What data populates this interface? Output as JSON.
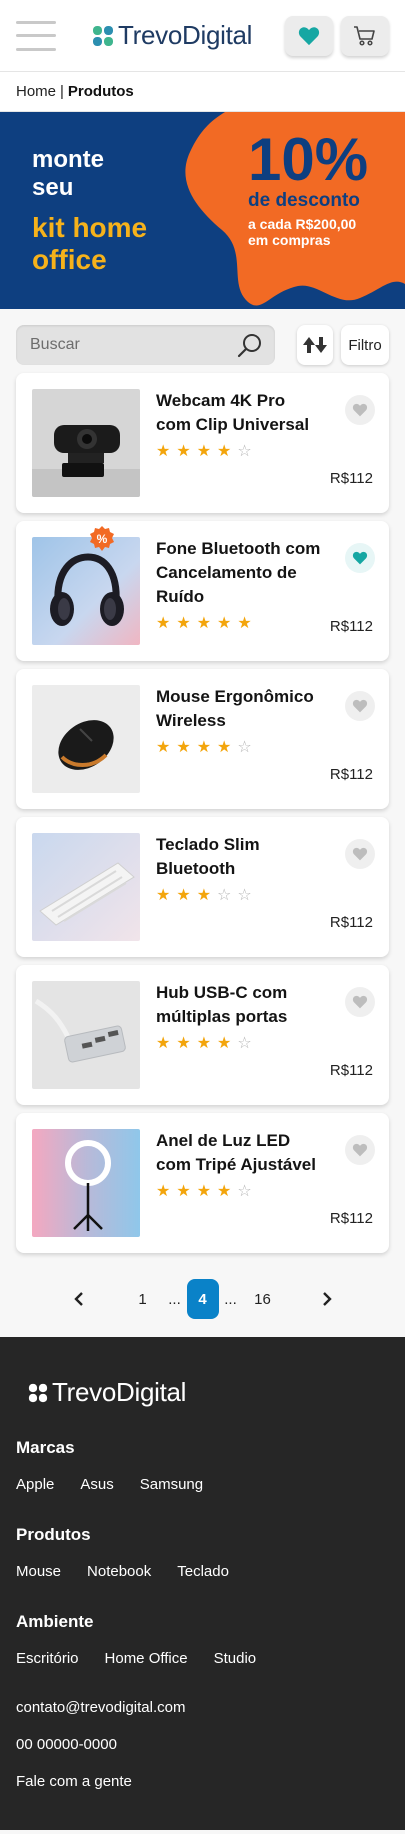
{
  "header": {
    "logo_text": "TrevoDigital",
    "colors": {
      "brand_green": "#3fb58e",
      "brand_blue": "#1f3b63",
      "teal": "#16a7a3"
    }
  },
  "breadcrumb": {
    "home": "Home",
    "separator": "|",
    "current": "Produtos"
  },
  "banner": {
    "line1": "monte",
    "line2": "seu",
    "line3": "kit home",
    "line4": "office",
    "discount": "10%",
    "discount_label": "de desconto",
    "condition1": "a cada R$200,00",
    "condition2": "em compras",
    "colors": {
      "blue": "#0e3f80",
      "orange": "#f26a24",
      "yellow": "#f6b21b"
    }
  },
  "search": {
    "placeholder": "Buscar",
    "filter_label": "Filtro"
  },
  "products": [
    {
      "name": "Webcam 4K Pro com Clip Universal",
      "rating": 4,
      "price": "R$112",
      "favorited": false,
      "icon": "webcam-image"
    },
    {
      "name": "Fone Bluetooth com Cancelamento de Ruído",
      "rating": 5,
      "price": "R$112",
      "favorited": true,
      "discount_badge": "%",
      "icon": "headphones-image"
    },
    {
      "name": "Mouse Ergonômico Wireless",
      "rating": 4,
      "price": "R$112",
      "favorited": false,
      "icon": "mouse-image"
    },
    {
      "name": "Teclado Slim Bluetooth",
      "rating": 3,
      "price": "R$112",
      "favorited": false,
      "icon": "keyboard-image"
    },
    {
      "name": "Hub USB-C com múltiplas portas",
      "rating": 4,
      "price": "R$112",
      "favorited": false,
      "icon": "usb-hub-image"
    },
    {
      "name": "Anel de Luz LED com Tripé Ajustável",
      "rating": 4,
      "price": "R$112",
      "favorited": false,
      "icon": "ring-light-image"
    }
  ],
  "pagination": {
    "first": "1",
    "dots1": "...",
    "current": "4",
    "dots2": "...",
    "last": "16"
  },
  "footer": {
    "logo_text": "TrevoDigital",
    "marcas_title": "Marcas",
    "marcas": [
      "Apple",
      "Asus",
      "Samsung"
    ],
    "produtos_title": "Produtos",
    "produtos": [
      "Mouse",
      "Notebook",
      "Teclado"
    ],
    "ambiente_title": "Ambiente",
    "ambiente": [
      "Escritório",
      "Home Office",
      "Studio"
    ],
    "email": "contato@trevodigital.com",
    "phone": "00 00000-0000",
    "contact_cta": "Fale com a gente"
  }
}
